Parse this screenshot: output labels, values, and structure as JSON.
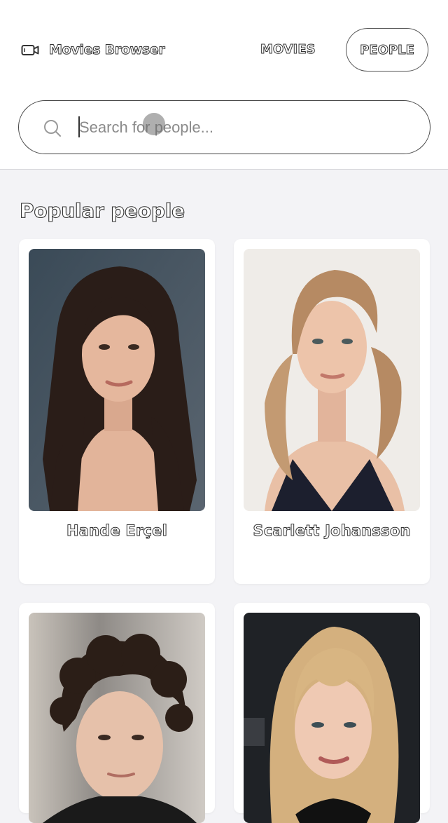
{
  "header": {
    "app_title": "Movies Browser",
    "brand_icon": "video-camera-icon",
    "nav": [
      {
        "label": "MOVIES",
        "active": false
      },
      {
        "label": "PEOPLE",
        "active": true
      }
    ]
  },
  "search": {
    "placeholder": "Search for people...",
    "value": "",
    "icon": "search-icon"
  },
  "section": {
    "title": "Popular people"
  },
  "people": [
    {
      "name": "Hande Erçel"
    },
    {
      "name": "Scarlett Johansson"
    },
    {
      "name": ""
    },
    {
      "name": ""
    }
  ],
  "colors": {
    "background": "#f3f3f6",
    "card": "#ffffff",
    "text": "#333333"
  }
}
